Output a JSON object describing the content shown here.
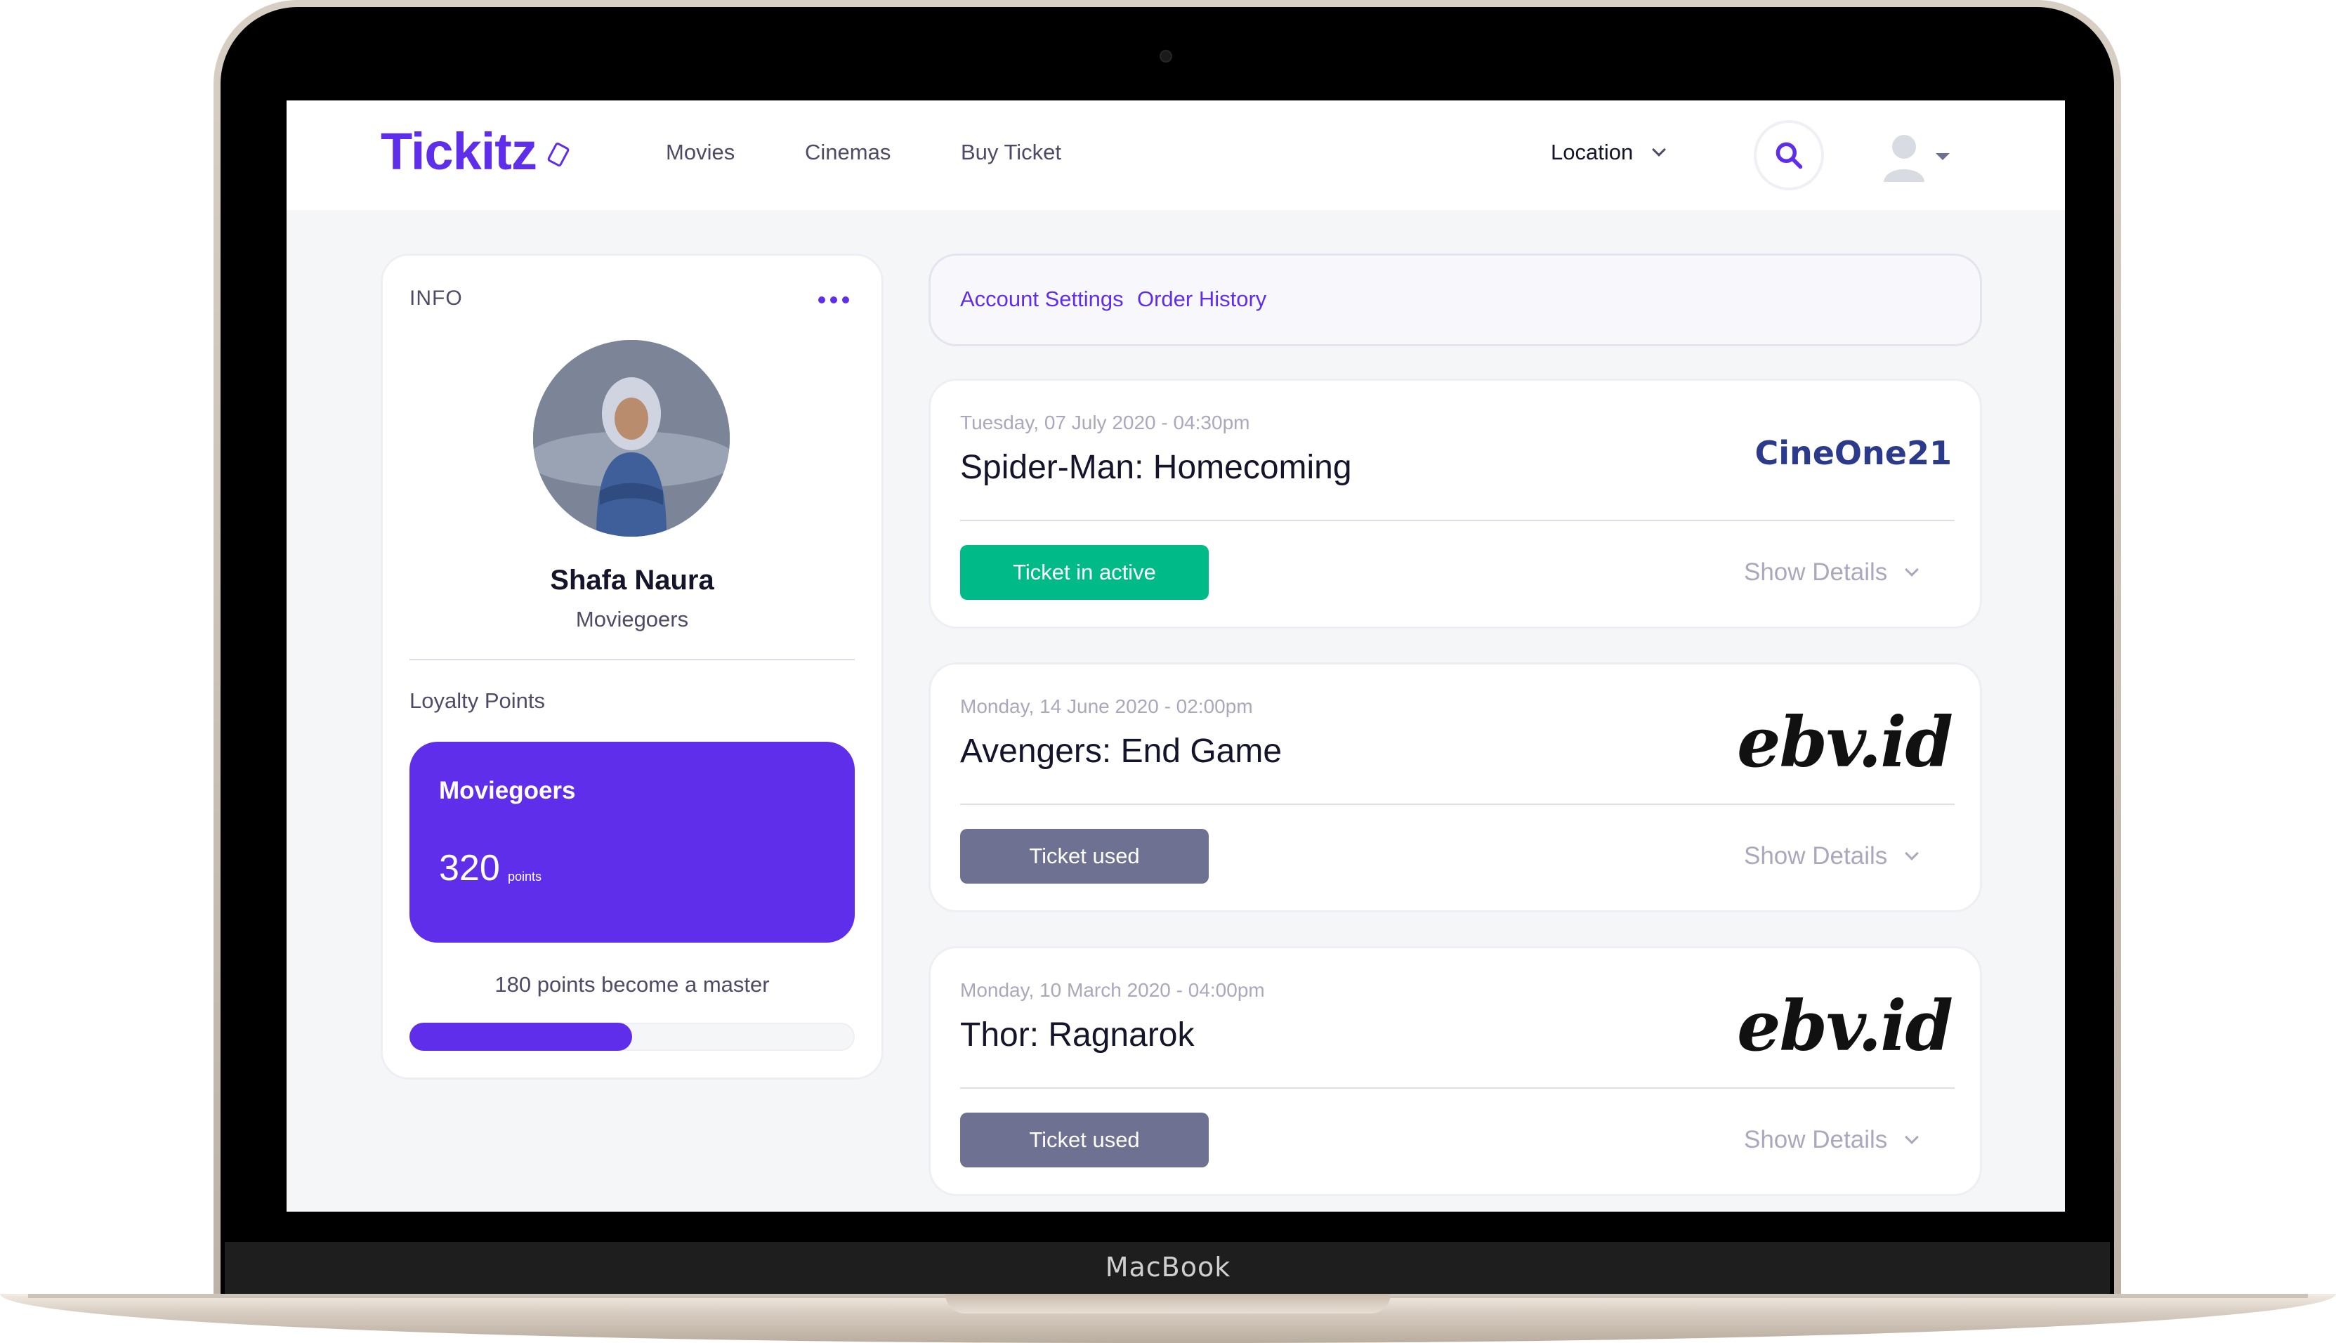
{
  "device": {
    "label": "MacBook"
  },
  "navbar": {
    "logo": "Tickitz",
    "links": [
      "Movies",
      "Cinemas",
      "Buy Ticket"
    ],
    "location_label": "Location"
  },
  "info": {
    "title": "INFO",
    "name": "Shafa Naura",
    "role": "Moviegoers",
    "loyalty_label": "Loyalty Points",
    "loyalty_card": {
      "tier": "Moviegoers",
      "points": "320",
      "unit": "points"
    },
    "progress_text": "180 points become a master",
    "progress_fraction": 0.5
  },
  "tabs": {
    "account": "Account Settings",
    "orders": "Order History"
  },
  "orders": [
    {
      "date": "Tuesday, 07 July 2020 - 04:30pm",
      "title": "Spider-Man: Homecoming",
      "cinema": "CineOne21",
      "status": "Ticket in active",
      "details": "Show Details"
    },
    {
      "date": "Monday, 14 June 2020 - 02:00pm",
      "title": "Avengers: End Game",
      "cinema": "ebv.id",
      "status": "Ticket used",
      "details": "Show Details"
    },
    {
      "date": "Monday, 10 March 2020 - 04:00pm",
      "title": "Thor: Ragnarok",
      "cinema": "ebv.id",
      "status": "Ticket used",
      "details": "Show Details"
    }
  ],
  "colors": {
    "accent": "#5f2eea",
    "active": "#00ba88",
    "used": "#6e7191"
  }
}
